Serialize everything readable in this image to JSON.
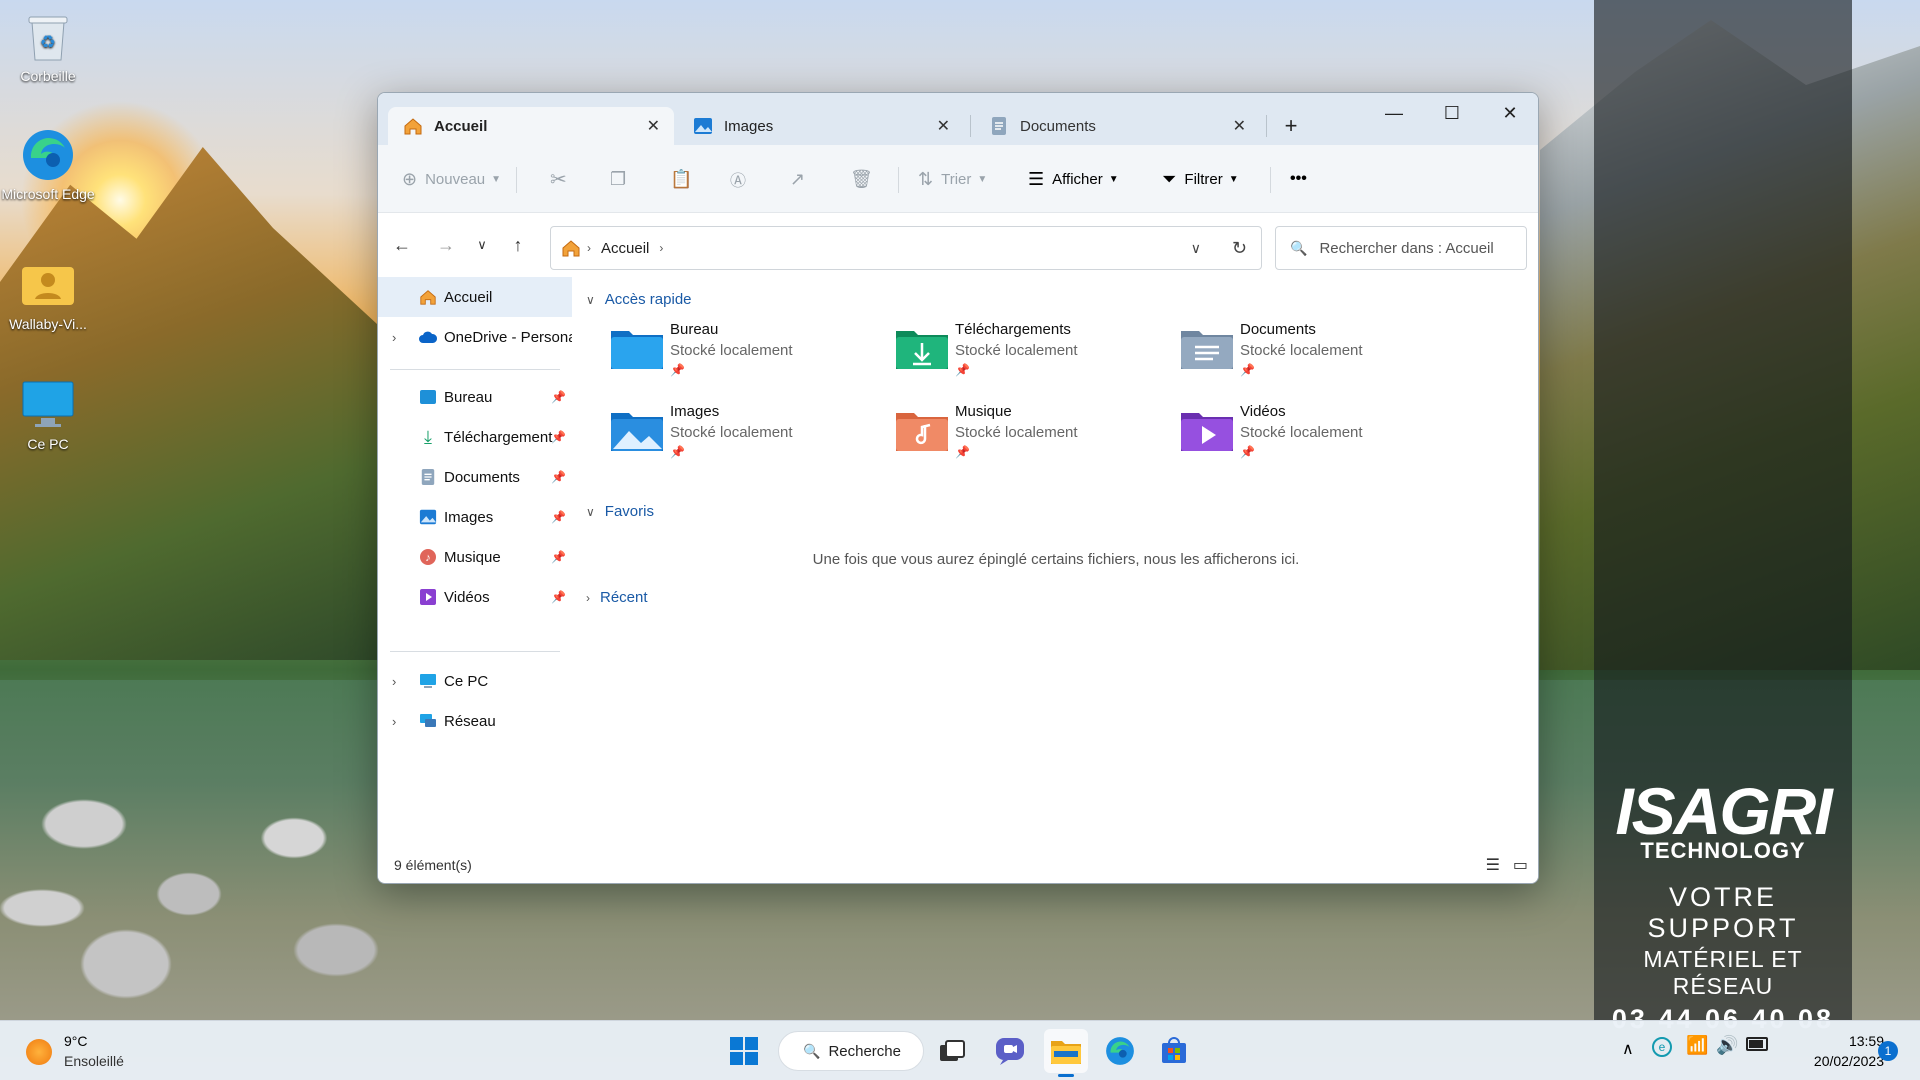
{
  "desktop": {
    "icons": [
      {
        "label": "Corbeille"
      },
      {
        "label": "Microsoft Edge"
      },
      {
        "label": "Wallaby-Vi..."
      },
      {
        "label": "Ce PC"
      }
    ],
    "brand": {
      "logo_line1": "ISAGRI",
      "logo_line2": "TECHNOLOGY",
      "line1": "VOTRE SUPPORT",
      "line2": "MATÉRIEL ET RÉSEAU",
      "phone": "03 44 06 40 08"
    }
  },
  "explorer": {
    "tabs": [
      {
        "label": "Accueil",
        "icon": "home-icon",
        "active": true
      },
      {
        "label": "Images",
        "icon": "images-icon",
        "active": false
      },
      {
        "label": "Documents",
        "icon": "documents-icon",
        "active": false
      }
    ],
    "toolbar": {
      "new_label": "Nouveau",
      "sort_label": "Trier",
      "view_label": "Afficher",
      "filter_label": "Filtrer",
      "more_label": "•••"
    },
    "address": {
      "crumb": "Accueil"
    },
    "search": {
      "placeholder": "Rechercher dans : Accueil"
    },
    "sidebar": {
      "home": "Accueil",
      "onedrive": "OneDrive - Persona",
      "pinned": [
        "Bureau",
        "Téléchargement",
        "Documents",
        "Images",
        "Musique",
        "Vidéos"
      ],
      "thispc": "Ce PC",
      "network": "Réseau"
    },
    "sections": {
      "quick": "Accès rapide",
      "favorites": "Favoris",
      "recent": "Récent"
    },
    "quick_access": [
      {
        "name": "Bureau",
        "sub": "Stocké localement"
      },
      {
        "name": "Téléchargements",
        "sub": "Stocké localement"
      },
      {
        "name": "Documents",
        "sub": "Stocké localement"
      },
      {
        "name": "Images",
        "sub": "Stocké localement"
      },
      {
        "name": "Musique",
        "sub": "Stocké localement"
      },
      {
        "name": "Vidéos",
        "sub": "Stocké localement"
      }
    ],
    "favorites_empty": "Une fois que vous aurez épinglé certains fichiers, nous les afficherons ici.",
    "status": "9 élément(s)"
  },
  "taskbar": {
    "weather": {
      "temp": "9°C",
      "cond": "Ensoleillé"
    },
    "search_label": "Recherche",
    "time": "13:59",
    "date": "20/02/2023",
    "notif_count": "1"
  },
  "colors": {
    "accent": "#1a5aa6",
    "window_bg": "#ffffff",
    "titlebar": "#dfe8f2"
  }
}
